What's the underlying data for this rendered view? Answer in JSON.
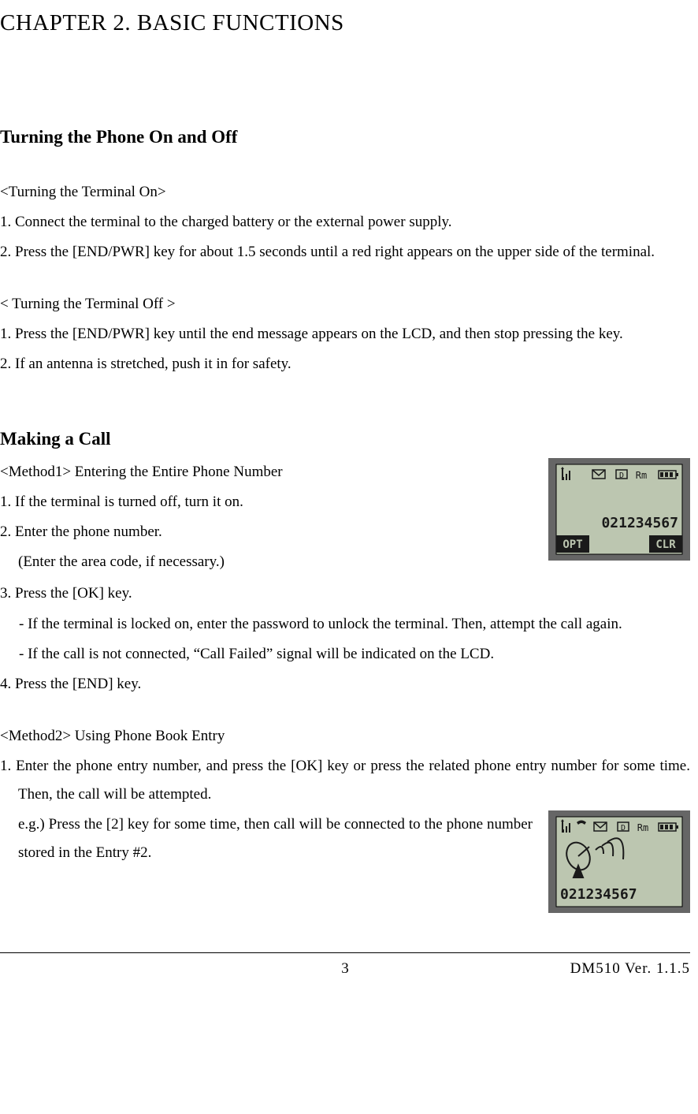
{
  "chapter_title": "CHAPTER 2. BASIC FUNCTIONS",
  "section1": {
    "heading": "Turning the Phone On and Off",
    "sub_on": "<Turning the Terminal On>",
    "on_1": "1.  Connect the terminal to the charged battery or the external power supply.",
    "on_2": "2.  Press the [END/PWR] key for about 1.5 seconds until a red right appears on the upper side of the terminal.",
    "sub_off": "< Turning the Terminal Off >",
    "off_1": "1. Press the [END/PWR] key until the end message appears on the LCD, and then stop pressing the key.",
    "off_2": "2. If an antenna is stretched, push it in for safety."
  },
  "section2": {
    "heading": "Making a Call",
    "m1_head": "<Method1> Entering the Entire Phone Number",
    "m1_1": "1. If the terminal is turned off, turn it on.",
    "m1_2": "2. Enter the phone number.",
    "m1_2_paren": "(Enter the area code, if necessary.)",
    "m1_3": "3. Press the [OK] key.",
    "m1_3_b1": "-    If the terminal is locked on, enter the password to unlock the terminal. Then, attempt the call again.",
    "m1_3_b2": "-    If the call is not connected, “Call Failed” signal will be indicated on the LCD.",
    "m1_4": "4. Press the [END] key.",
    "m2_head": "<Method2> Using Phone Book Entry",
    "m2_1": "1. Enter the phone entry number, and press the [OK] key or press the related phone entry number for some time. Then, the call will be attempted.",
    "m2_eg": "e.g.) Press the [2] key for some time, then call will be connected to the phone number stored in the Entry #2."
  },
  "lcd1": {
    "number": "021234567",
    "opt": "OPT",
    "clr": "CLR"
  },
  "lcd2": {
    "number": "021234567"
  },
  "footer": {
    "page": "3",
    "model": "DM510  Ver. 1.1.5"
  }
}
